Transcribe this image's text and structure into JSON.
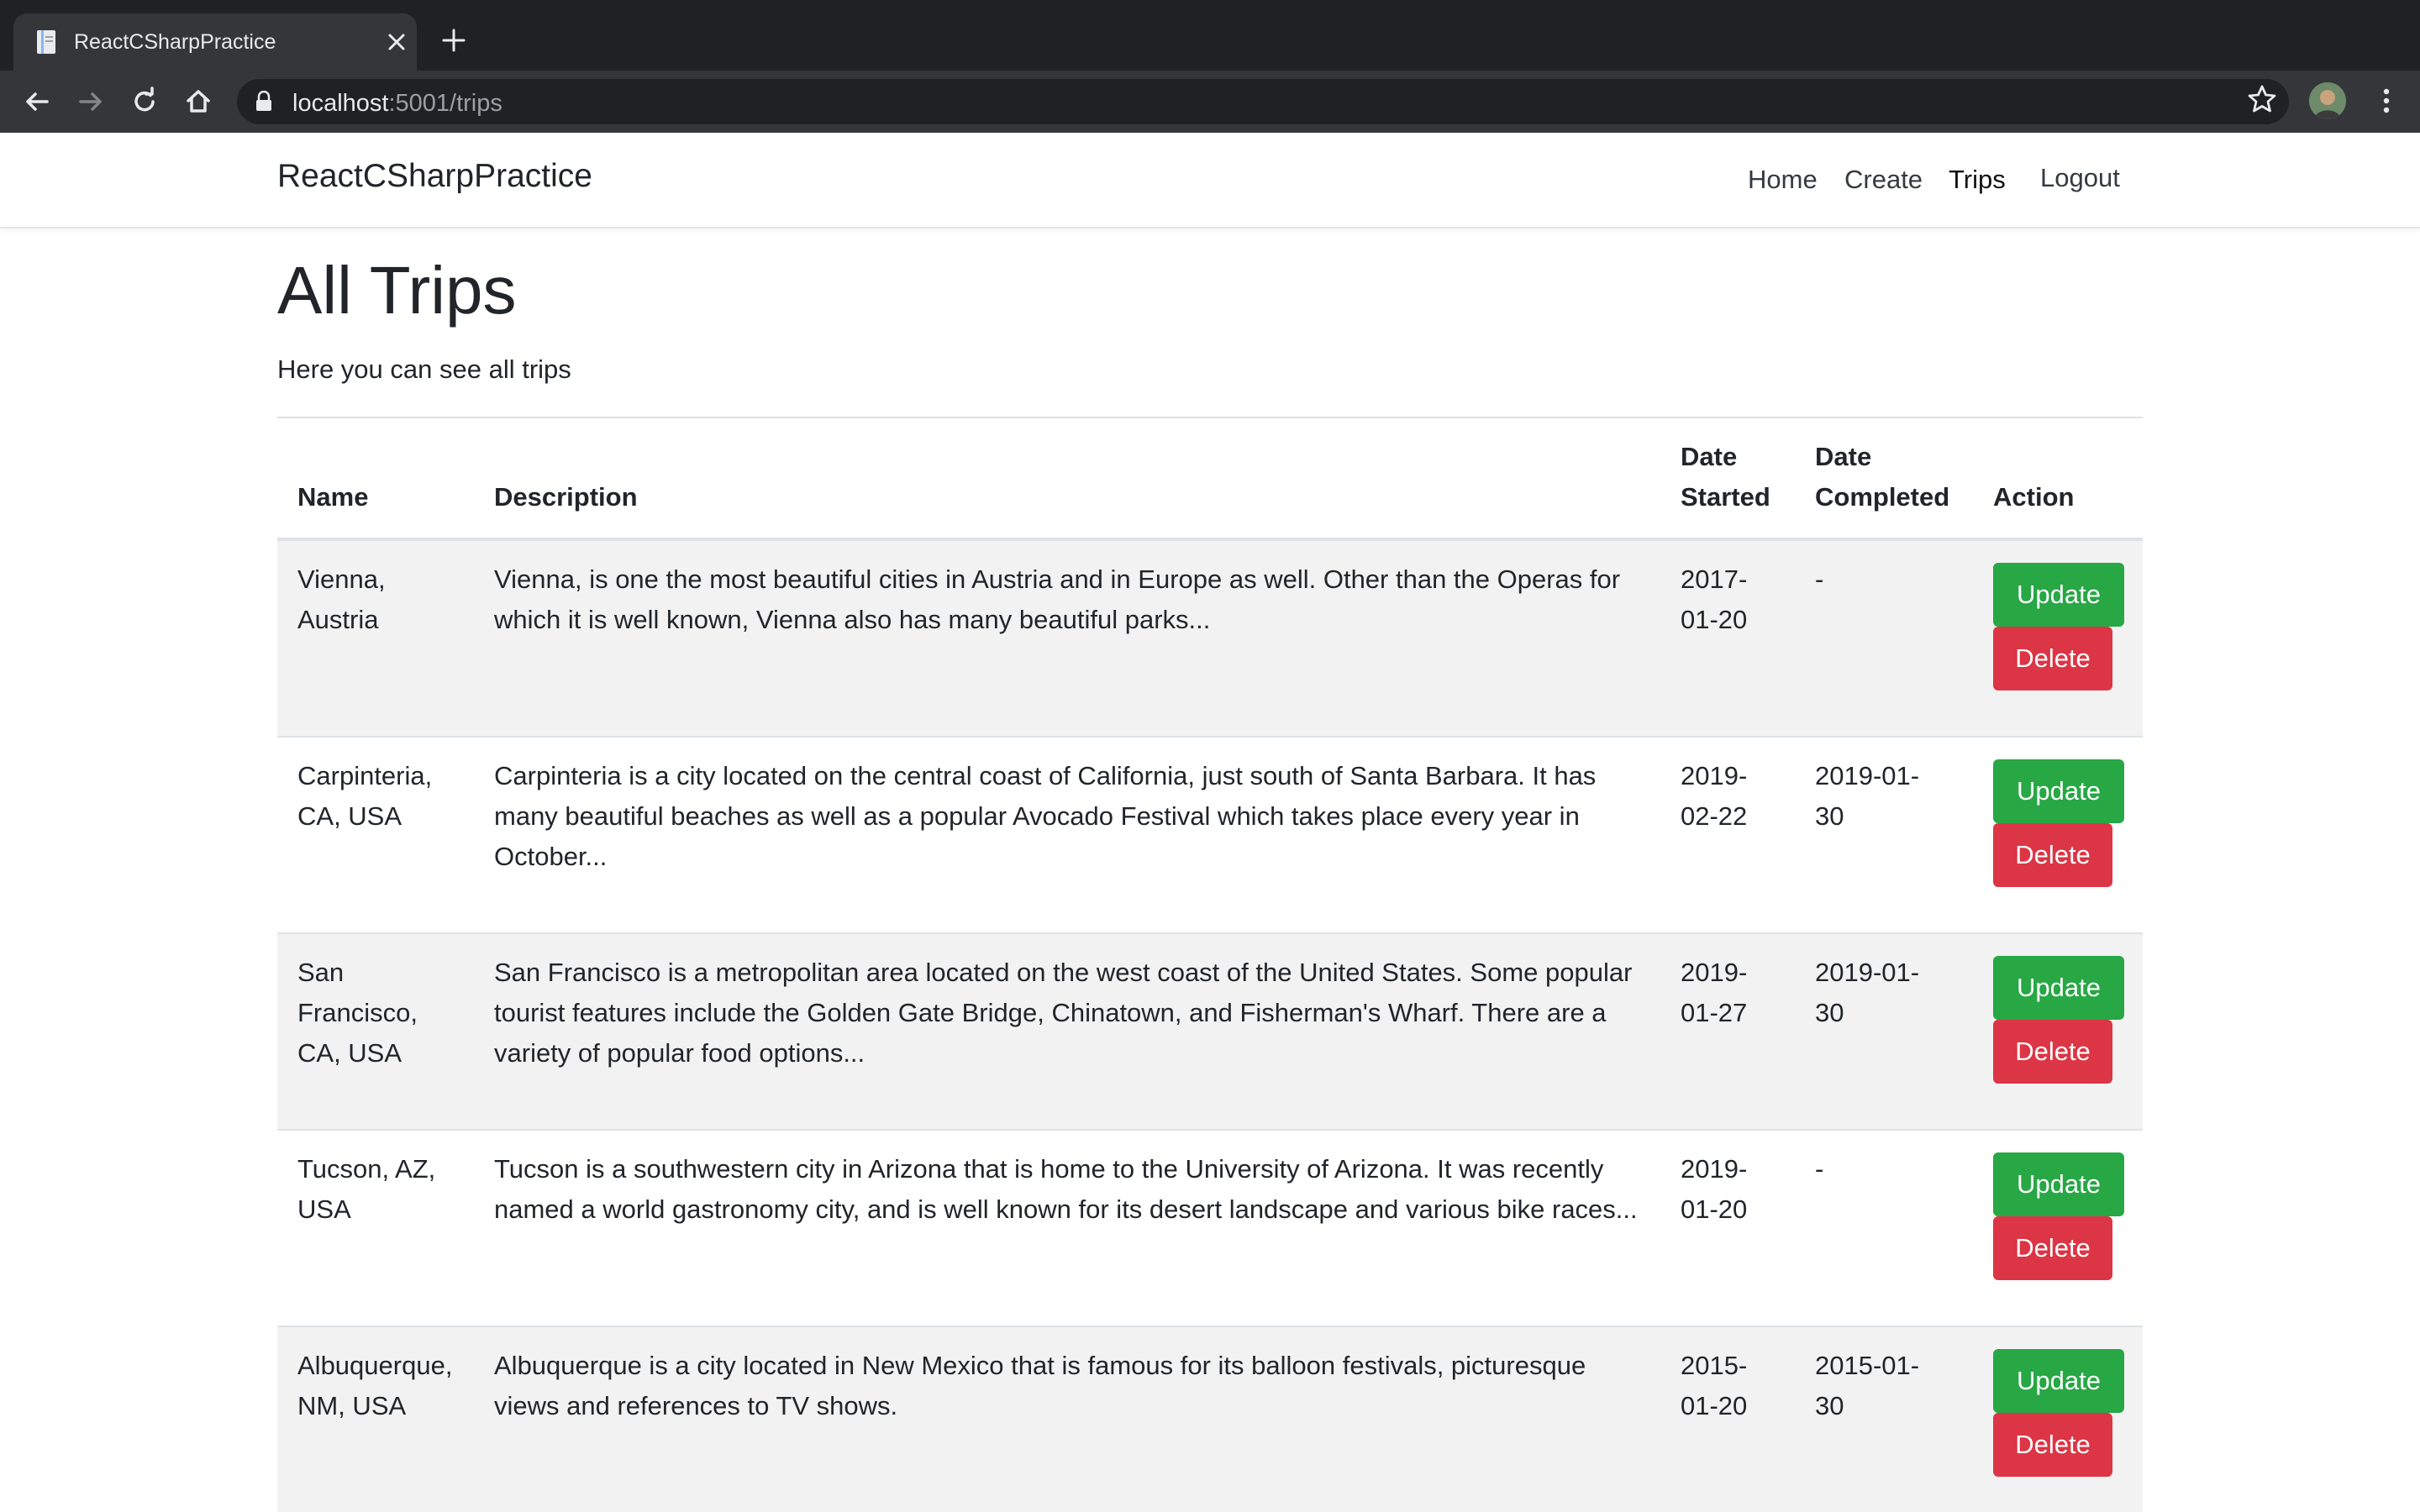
{
  "browser": {
    "tab_title": "ReactCSharpPractice",
    "url_host": "localhost",
    "url_rest": ":5001/trips"
  },
  "navbar": {
    "brand": "ReactCSharpPractice",
    "links": [
      "Home",
      "Create",
      "Trips",
      "Logout"
    ]
  },
  "page": {
    "title": "All Trips",
    "subtitle": "Here you can see all trips"
  },
  "table": {
    "headers": {
      "name": "Name",
      "description": "Description",
      "date_started_1": "Date",
      "date_started_2": "Started",
      "date_completed_1": "Date",
      "date_completed_2": "Completed",
      "action": "Action"
    },
    "update_label": "Update",
    "delete_label": "Delete",
    "rows": [
      {
        "name": [
          "Vienna,",
          "Austria"
        ],
        "description": [
          "Vienna, is one the most beautiful cities in Austria and in Europe as well. Other than the Operas for",
          "which it is well known, Vienna also has many beautiful parks..."
        ],
        "date_started": [
          "2017-",
          "01-20"
        ],
        "date_completed": [
          "-"
        ]
      },
      {
        "name": [
          "Carpinteria,",
          "CA, USA"
        ],
        "description": [
          "Carpinteria is a city located on the central coast of California, just south of Santa Barbara. It has",
          "many beautiful beaches as well as a popular Avocado Festival which takes place every year in",
          "October..."
        ],
        "date_started": [
          "2019-",
          "02-22"
        ],
        "date_completed": [
          "2019-01-",
          "30"
        ]
      },
      {
        "name": [
          "San",
          "Francisco,",
          "CA, USA"
        ],
        "description": [
          "San Francisco is a metropolitan area located on the west coast of the United States. Some popular",
          "tourist features include the Golden Gate Bridge, Chinatown, and Fisherman's Wharf. There are a",
          "variety of popular food options..."
        ],
        "date_started": [
          "2019-",
          "01-27"
        ],
        "date_completed": [
          "2019-01-",
          "30"
        ]
      },
      {
        "name": [
          "Tucson, AZ,",
          "USA"
        ],
        "description": [
          "Tucson is a southwestern city in Arizona that is home to the University of Arizona. It was recently",
          "named a world gastronomy city, and is well known for its desert landscape and various bike races..."
        ],
        "date_started": [
          "2019-",
          "01-20"
        ],
        "date_completed": [
          "-"
        ]
      },
      {
        "name": [
          "Albuquerque,",
          "NM, USA"
        ],
        "description": [
          "Albuquerque is a city located in New Mexico that is famous for its balloon festivals, picturesque",
          "views and references to TV shows."
        ],
        "date_started": [
          "2015-",
          "01-20"
        ],
        "date_completed": [
          "2015-01-",
          "30"
        ]
      }
    ]
  }
}
